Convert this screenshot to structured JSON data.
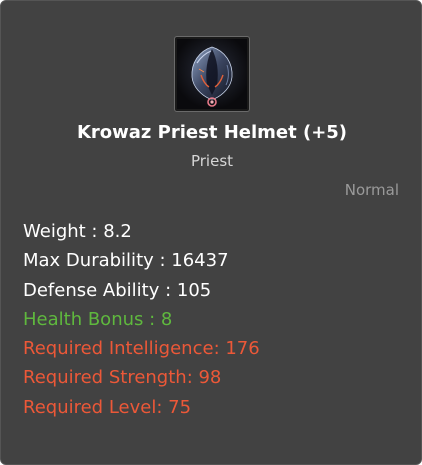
{
  "item": {
    "name": "Krowaz Priest Helmet (+5)",
    "class": "Priest",
    "rarity": "Normal",
    "icon": "helmet-icon"
  },
  "stats": [
    {
      "text": "Weight : 8.2",
      "color": "#ffffff"
    },
    {
      "text": "Max Durability : 16437",
      "color": "#ffffff"
    },
    {
      "text": "Defense Ability : 105",
      "color": "#ffffff"
    },
    {
      "text": "Health Bonus : 8",
      "color": "#5fb83e"
    },
    {
      "text": "Required Intelligence: 176",
      "color": "#ec5838"
    },
    {
      "text": "Required Strength: 98",
      "color": "#ec5838"
    },
    {
      "text": "Required Level: 75",
      "color": "#ec5838"
    }
  ],
  "colors": {
    "background": "#424242",
    "bonus": "#5fb83e",
    "requirement": "#ec5838",
    "rarity": "#9a9a9a"
  }
}
